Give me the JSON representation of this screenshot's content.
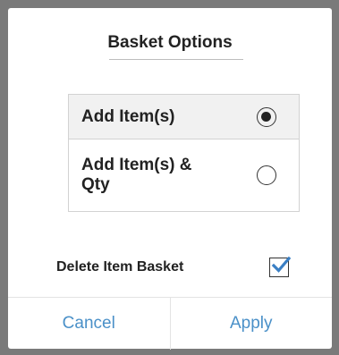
{
  "dialog": {
    "title": "Basket Options",
    "options": [
      {
        "label": "Add Item(s)",
        "selected": true
      },
      {
        "label": "Add Item(s) & Qty",
        "selected": false
      }
    ],
    "delete_item_basket": {
      "label": "Delete Item Basket",
      "checked": true
    },
    "buttons": {
      "cancel": "Cancel",
      "apply": "Apply"
    },
    "colors": {
      "accent": "#4a90c8",
      "checkmark": "#3a7fc4",
      "overlay": "#7a7a7a"
    }
  }
}
